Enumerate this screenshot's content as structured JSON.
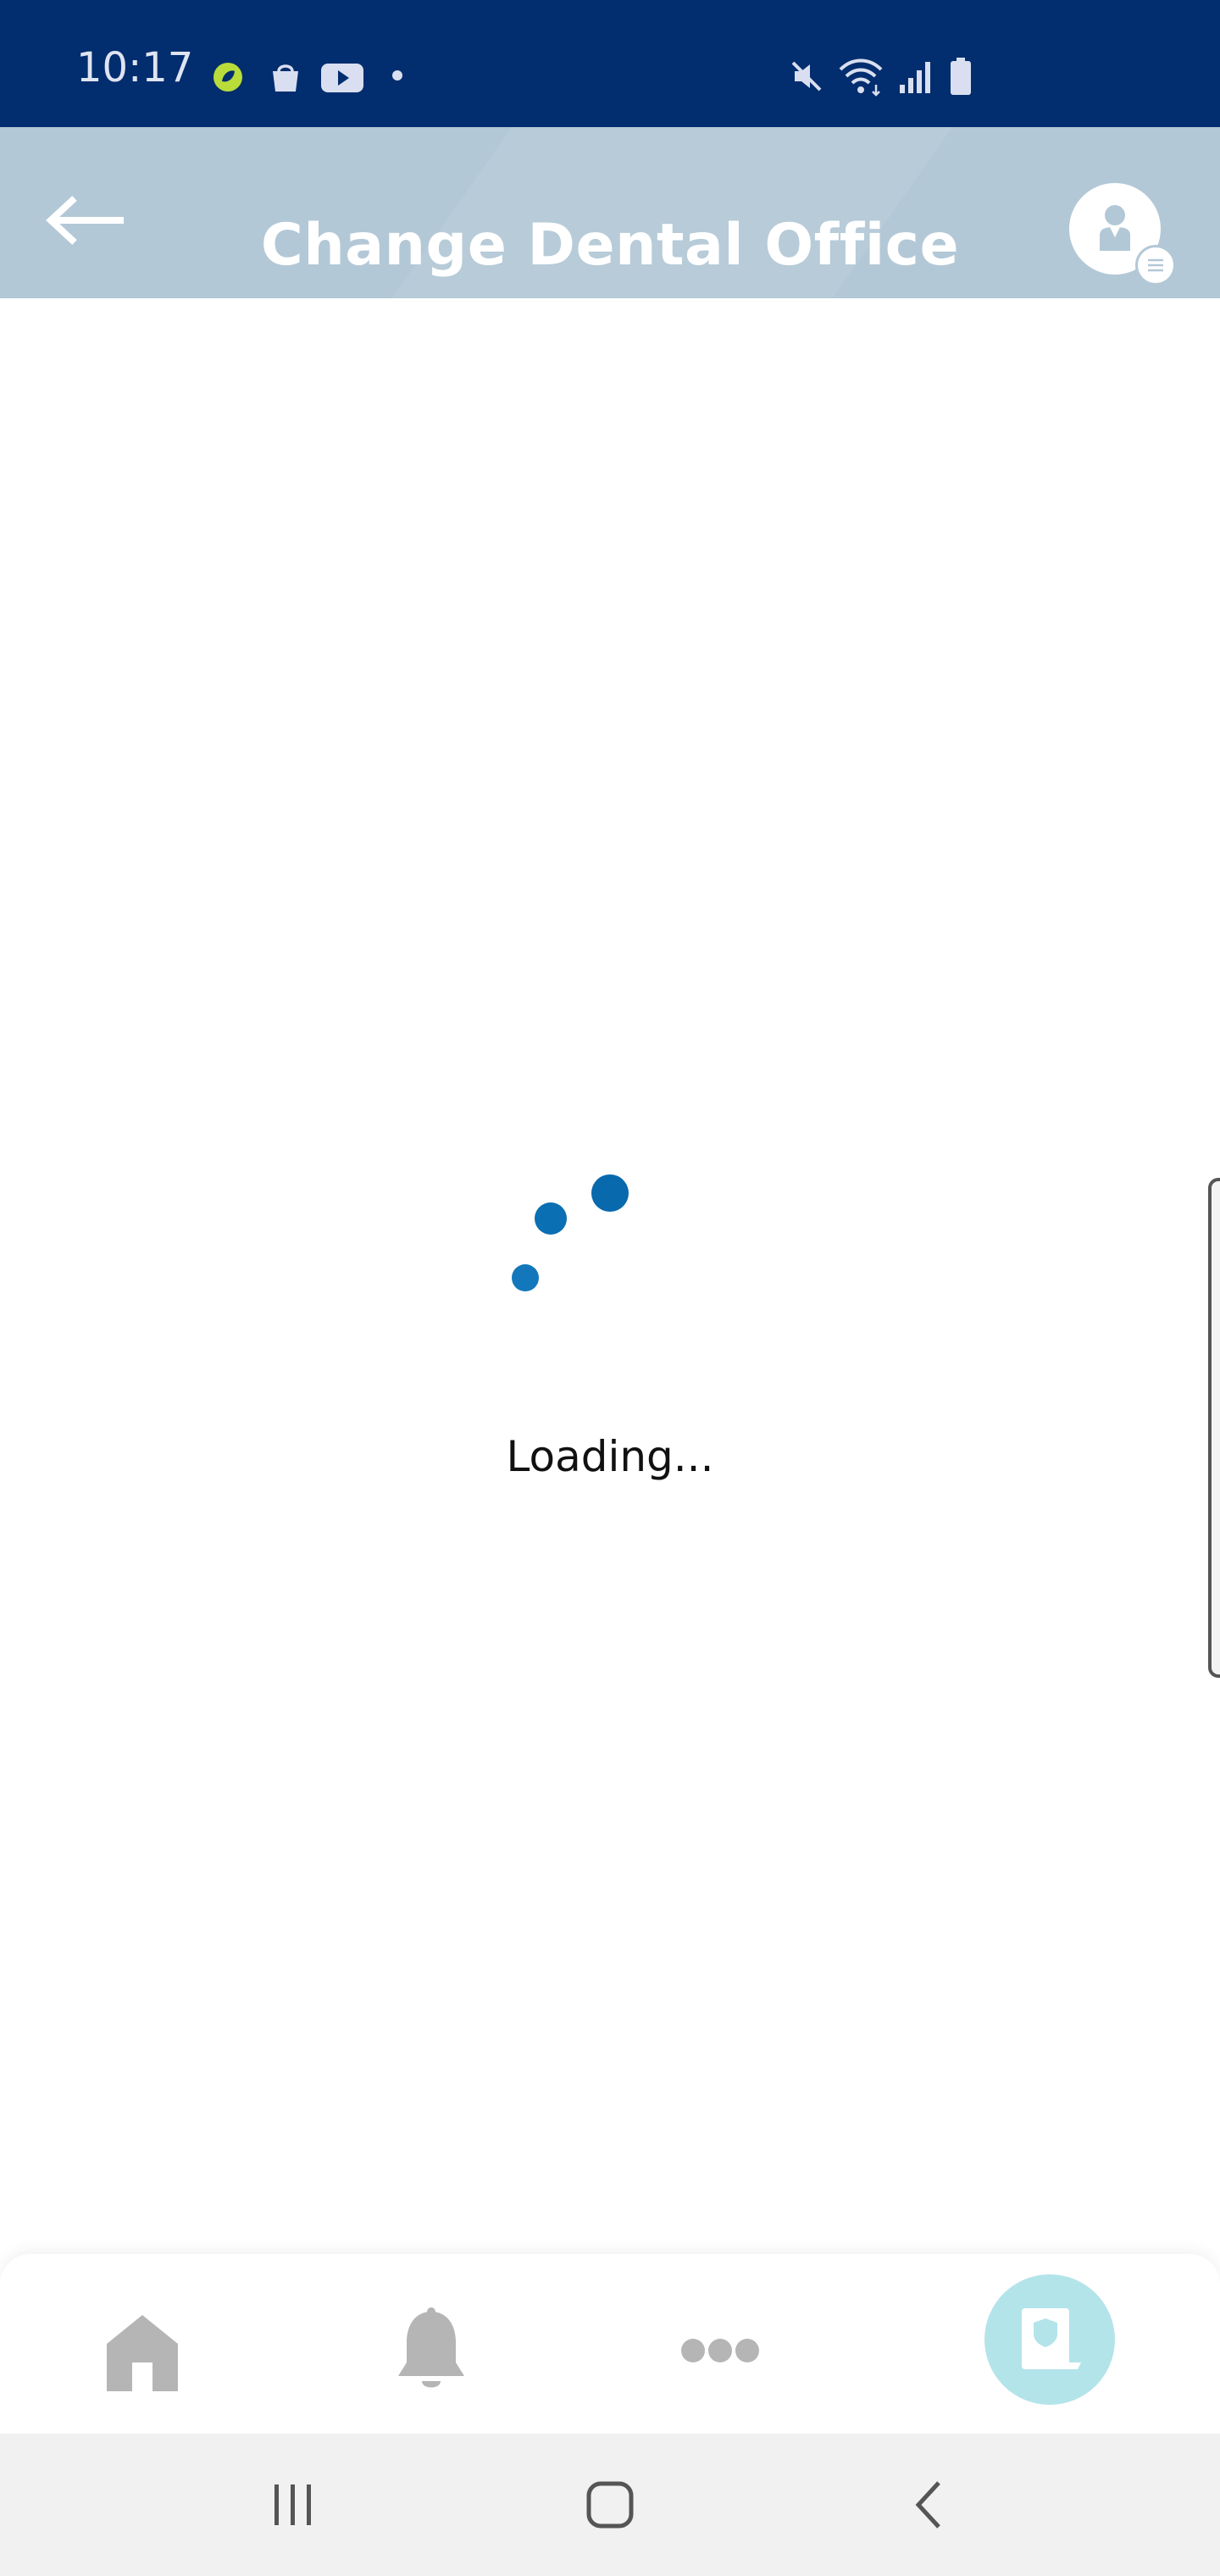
{
  "status_bar": {
    "time": "10:17",
    "left_icons": [
      "app-notification-icon",
      "shopping-bag-icon",
      "youtube-icon",
      "more-notifications-dot-icon"
    ],
    "right_icons": [
      "mute-icon",
      "wifi-icon",
      "signal-icon",
      "battery-icon"
    ]
  },
  "header": {
    "title": "Change Dental Office",
    "back_icon": "arrow-left-icon",
    "avatar_icon": "profile-icon",
    "avatar_badge_icon": "menu-icon",
    "background_color": "#b3c8d6"
  },
  "content": {
    "loading_text": "Loading...",
    "spinner_color": "#0a6fb3"
  },
  "bottom_nav": {
    "items": [
      {
        "icon": "home-icon"
      },
      {
        "icon": "bell-icon"
      },
      {
        "icon": "more-horizontal-icon"
      },
      {
        "icon": "insurance-card-icon"
      }
    ],
    "fab_color": "#b3e4ea"
  },
  "system_nav": {
    "buttons": [
      "recent-apps-icon",
      "home-button-icon",
      "back-chevron-icon"
    ]
  }
}
